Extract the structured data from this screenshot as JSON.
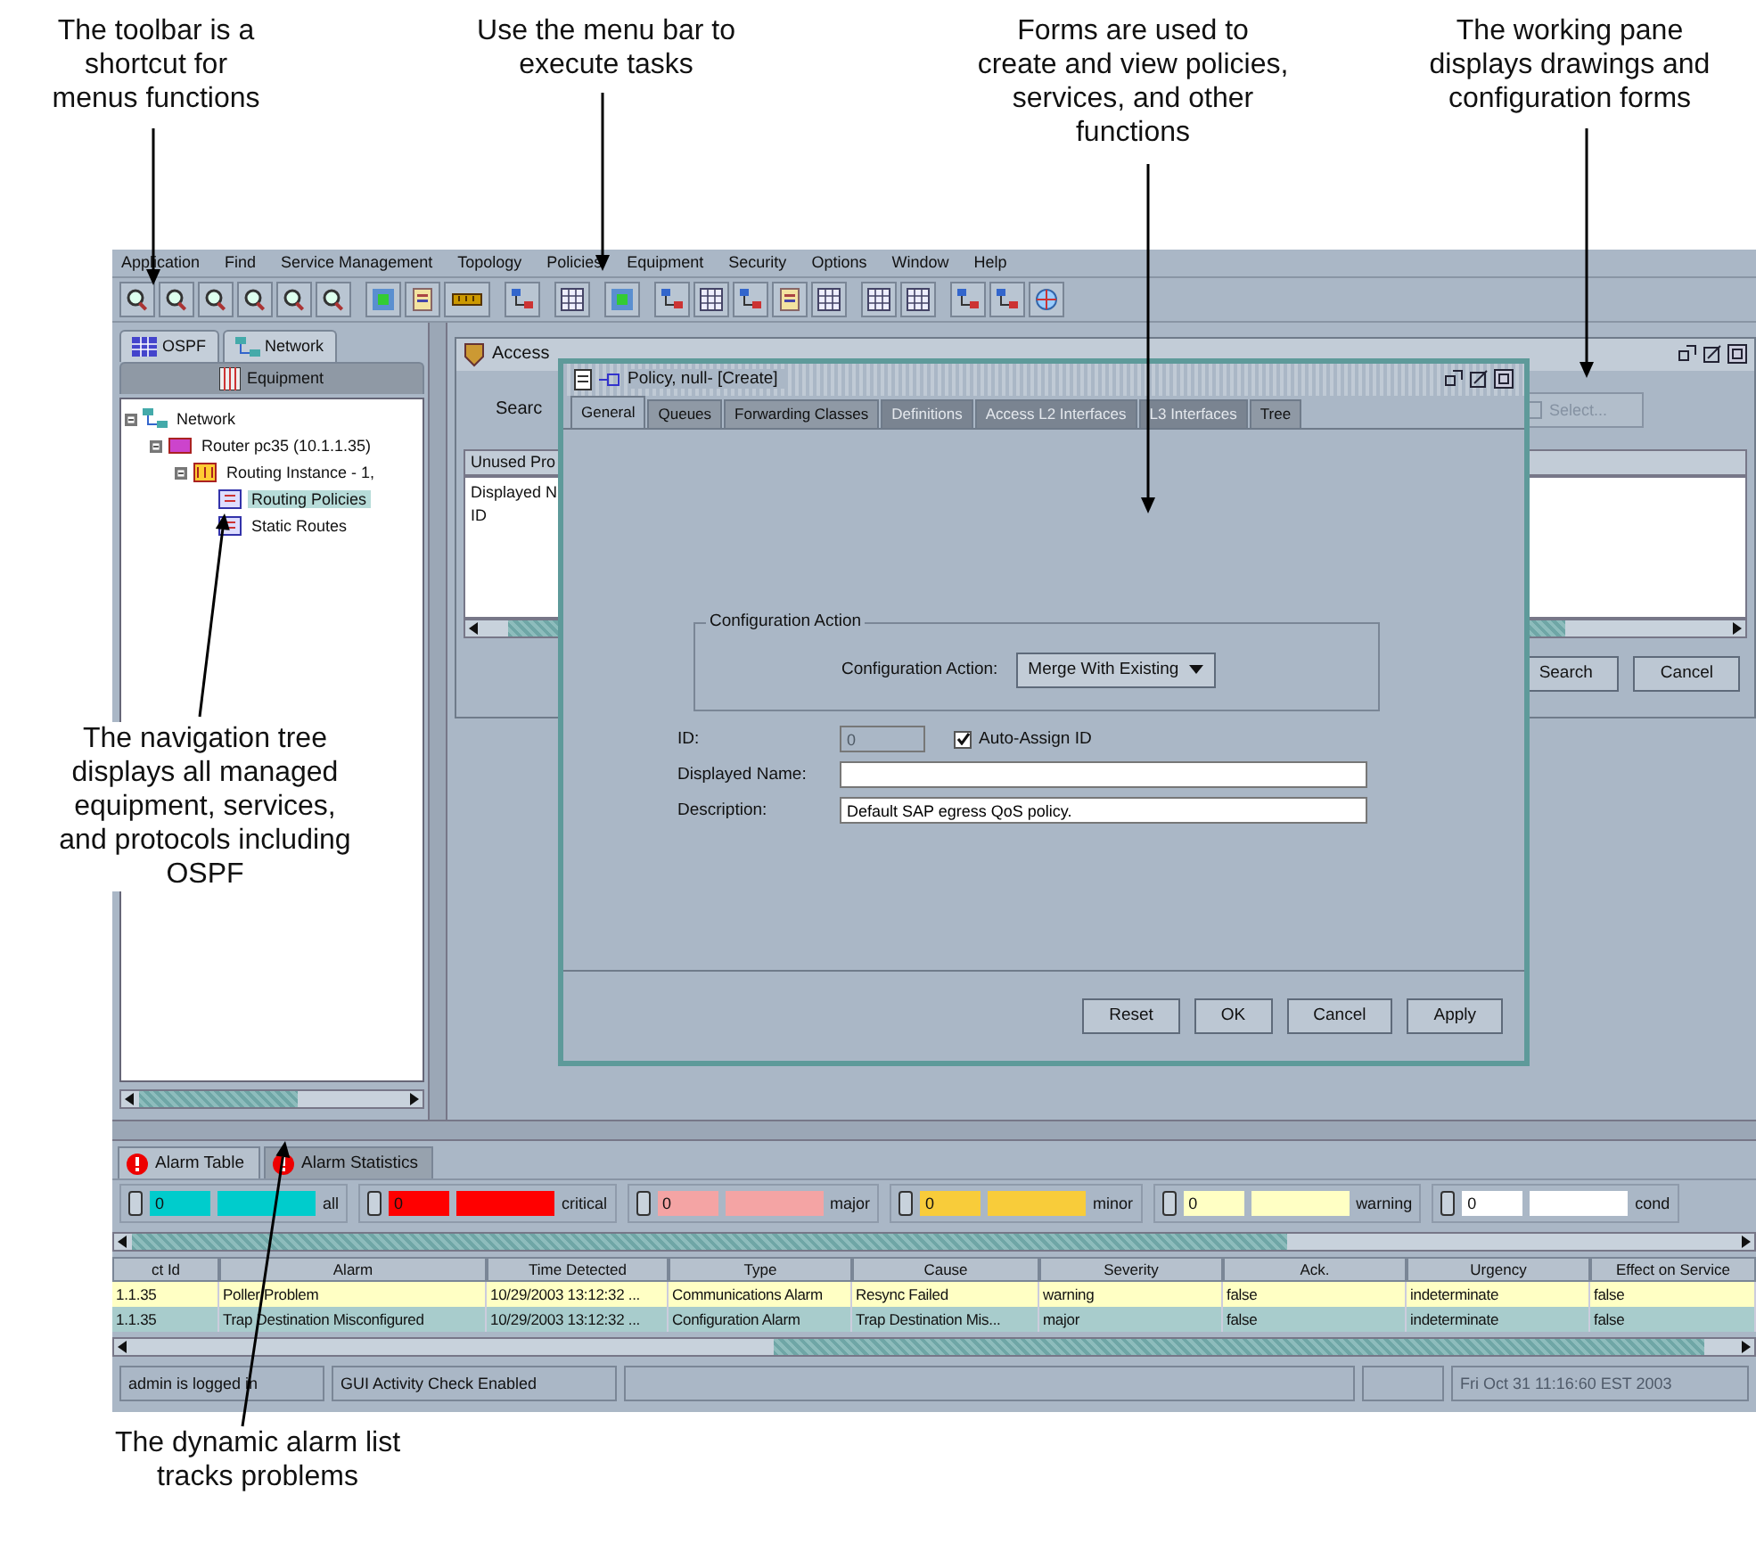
{
  "callouts": [
    {
      "kind": "top",
      "text": "The toolbar is a shortcut for menus functions"
    },
    {
      "kind": "top",
      "text": "Use the menu bar to execute tasks"
    },
    {
      "kind": "top",
      "text": "Forms are used to create and view policies, services, and other functions"
    },
    {
      "kind": "top",
      "text": "The working pane displays drawings and configuration forms"
    },
    {
      "kind": "left",
      "text": "The navigation tree displays all managed equipment, services, and protocols including OSPF"
    },
    {
      "kind": "bottom",
      "text": "The dynamic alarm list tracks problems"
    }
  ],
  "menu_bar": [
    "Application",
    "Find",
    "Service Management",
    "Topology",
    "Policies",
    "Equipment",
    "Security",
    "Options",
    "Window",
    "Help"
  ],
  "navigation": {
    "tabs": [
      {
        "label": "OSPF",
        "selected": false
      },
      {
        "label": "Network",
        "selected": false
      }
    ],
    "front_tabs": [
      {
        "label": "Equipment",
        "selected": true
      }
    ],
    "tree": [
      {
        "label": "Network",
        "expanded": true,
        "selected": false,
        "children": [
          {
            "label": "Router pc35 (10.1.1.35)",
            "expanded": true,
            "selected": false,
            "children": [
              {
                "label": "Routing Instance - 1,",
                "expanded": true,
                "selected": false,
                "children": [
                  {
                    "label": "Routing Policies",
                    "selected": true
                  },
                  {
                    "label": "Static Routes",
                    "selected": false
                  }
                ]
              }
            ]
          }
        ]
      }
    ]
  },
  "working_pane": {
    "window_title": "Access",
    "search_label": "Searc",
    "select_button": {
      "label": "Select...",
      "disabled": true
    },
    "list_title": "Unused Pro",
    "list_items": [
      "Displayed N",
      "ID"
    ],
    "buttons": [
      "Search",
      "Cancel"
    ]
  },
  "dialog": {
    "title": "Policy, null- [Create]",
    "tabs": [
      {
        "label": "General",
        "selected": true,
        "disabled": false
      },
      {
        "label": "Queues",
        "selected": false,
        "disabled": false
      },
      {
        "label": "Forwarding Classes",
        "selected": false,
        "disabled": false
      },
      {
        "label": "Definitions",
        "selected": false,
        "disabled": true
      },
      {
        "label": "Access L2 Interfaces",
        "selected": false,
        "disabled": true
      },
      {
        "label": "L3 Interfaces",
        "selected": false,
        "disabled": true
      },
      {
        "label": "Tree",
        "selected": false,
        "disabled": false
      }
    ],
    "group_title": "Configuration Action",
    "action_label": "Configuration Action:",
    "action_value": "Merge With Existing",
    "id_label": "ID:",
    "id_value": "0",
    "id_disabled": true,
    "auto_assign": {
      "label": "Auto-Assign ID",
      "checked": true
    },
    "name_label": "Displayed Name:",
    "description_label": "Description:",
    "description_value": "Default SAP egress QoS policy.",
    "buttons": [
      "Reset",
      "OK",
      "Cancel",
      "Apply"
    ]
  },
  "alarms": {
    "tabs": [
      {
        "label": "Alarm Table",
        "selected": true
      },
      {
        "label": "Alarm Statistics",
        "selected": false
      }
    ],
    "filters": [
      {
        "count": "0",
        "label": "all",
        "color": "#00cccc"
      },
      {
        "count": "0",
        "label": "critical",
        "color": "#ff0000"
      },
      {
        "count": "0",
        "label": "major",
        "color": "#f4a4a4"
      },
      {
        "count": "0",
        "label": "minor",
        "color": "#f8cc3a"
      },
      {
        "count": "0",
        "label": "warning",
        "color": "#ffffc4"
      },
      {
        "count": "0",
        "label": "cond",
        "color": "#ffffff"
      }
    ],
    "columns": [
      "ct Id",
      "Alarm",
      "Time Detected",
      "Type",
      "Cause",
      "Severity",
      "Ack.",
      "Urgency",
      "Effect on Service"
    ],
    "rows": [
      {
        "color": "#ffffc4",
        "cells": [
          "1.1.35",
          "Poller Problem",
          "10/29/2003 13:12:32 ...",
          "Communications Alarm",
          "Resync Failed",
          "warning",
          "false",
          "indeterminate",
          "false"
        ]
      },
      {
        "color": "#a8cccc",
        "cells": [
          "1.1.35",
          "Trap Destination Misconfigured",
          "10/29/2003 13:12:32 ...",
          "Configuration Alarm",
          "Trap Destination Mis...",
          "major",
          "false",
          "indeterminate",
          "false"
        ]
      }
    ]
  },
  "status_bar": [
    "admin is logged in",
    "GUI Activity Check Enabled",
    "Fri Oct 31 11:16:60 EST 2003"
  ]
}
